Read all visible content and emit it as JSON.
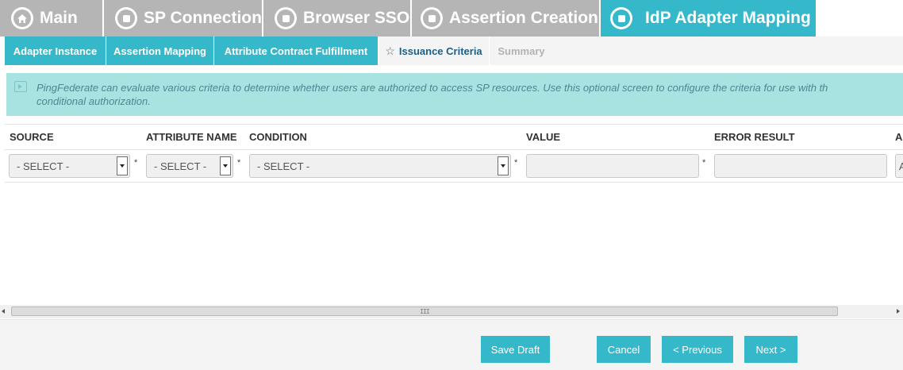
{
  "top_tabs": [
    {
      "label": "Main",
      "icon": "home-icon"
    },
    {
      "label": "SP Connection",
      "icon": "circle-square-icon"
    },
    {
      "label": "Browser SSO",
      "icon": "circle-square-icon"
    },
    {
      "label": "Assertion Creation",
      "icon": "circle-square-icon"
    },
    {
      "label": "IdP Adapter Mapping",
      "icon": "circle-square-icon",
      "active": true
    }
  ],
  "sub_tabs": [
    {
      "label": "Adapter Instance"
    },
    {
      "label": "Assertion Mapping"
    },
    {
      "label": "Attribute Contract Fulfillment"
    },
    {
      "label": "Issuance Criteria",
      "active": true,
      "icon": "star-icon"
    },
    {
      "label": "Summary",
      "disabled": true
    }
  ],
  "info": {
    "line1": "PingFederate can evaluate various criteria to determine whether users are authorized to access SP resources. Use this optional screen to configure the criteria for use with th",
    "line2": "conditional authorization."
  },
  "table": {
    "columns": [
      "SOURCE",
      "ATTRIBUTE NAME",
      "CONDITION",
      "VALUE",
      "ERROR RESULT",
      "A"
    ],
    "row": {
      "source": "- SELECT -",
      "attribute_name": "- SELECT -",
      "condition": "- SELECT -",
      "value": "",
      "error_result": "",
      "last_value": "A",
      "required_marker": "*"
    }
  },
  "scrollbar": {
    "grip": "III"
  },
  "footer": {
    "save_draft": "Save Draft",
    "cancel": "Cancel",
    "previous": "< Previous",
    "next": "Next >"
  },
  "colors": {
    "accent": "#35b8ca",
    "inactive_tab": "#b5b5b5",
    "info_bg": "#a9e3e1",
    "info_text": "#4e8592",
    "active_subtab_text": "#1b5f86"
  }
}
